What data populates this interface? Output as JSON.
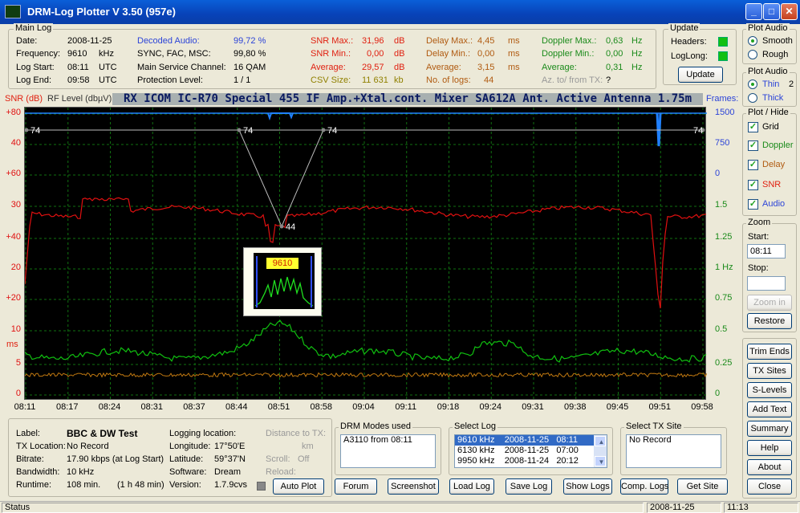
{
  "window": {
    "title": "DRM-Log Plotter  V 3.50   (957e)",
    "min": "_",
    "max": "□",
    "close": "✕"
  },
  "mainlog": {
    "legend": "Main Log",
    "date_l": "Date:",
    "date_v": "2008-11-25",
    "freq_l": "Frequency:",
    "freq_v": "9610",
    "freq_u": "kHz",
    "start_l": "Log Start:",
    "start_v": "08:11",
    "start_u": "UTC",
    "end_l": "Log End:",
    "end_v": "09:58",
    "end_u": "UTC",
    "audio_l": "Decoded Audio:",
    "audio_v": "99,72 %",
    "sync_l": "SYNC, FAC, MSC:",
    "sync_v": "99,80 %",
    "msc_l": "Main Service Channel:",
    "msc_v": "16  QAM",
    "prot_l": "Protection Level:",
    "prot_v": "1 / 1",
    "snrmax_l": "SNR Max.:",
    "snrmax_v": "31,96",
    "snrmax_u": "dB",
    "snrmin_l": "SNR Min.:",
    "snrmin_v": "0,00",
    "snrmin_u": "dB",
    "snravg_l": "Average:",
    "snravg_v": "29,57",
    "snravg_u": "dB",
    "csv_l": "CSV Size:",
    "csv_v": "11 631",
    "csv_u": "kb",
    "dmax_l": "Delay Max.:",
    "dmax_v": "4,45",
    "dmax_u": "ms",
    "dmin_l": "Delay Min.:",
    "dmin_v": "0,00",
    "dmin_u": "ms",
    "davg_l": "Average:",
    "davg_v": "3,15",
    "davg_u": "ms",
    "nlogs_l": "No. of logs:",
    "nlogs_v": "44",
    "domax_l": "Doppler Max.:",
    "domax_v": "0,63",
    "domax_u": "Hz",
    "domin_l": "Doppler Min.:",
    "domin_v": "0,00",
    "domin_u": "Hz",
    "doavg_l": "Average:",
    "doavg_v": "0,31",
    "doavg_u": "Hz",
    "az_l": "Az. to/ from TX:",
    "az_v": "?"
  },
  "update": {
    "legend": "Update",
    "headers": "Headers:",
    "loglong": "LogLong:",
    "button": "Update"
  },
  "plotaudio": {
    "legend": "Plot Audio",
    "smooth": "Smooth",
    "rough": "Rough"
  },
  "plotaudio2": {
    "legend": "Plot Audio",
    "thin": "Thin",
    "thick": "Thick",
    "num": "2"
  },
  "plothide": {
    "legend": "Plot / Hide",
    "grid": "Grid",
    "doppler": "Doppler",
    "delay": "Delay",
    "snr": "SNR",
    "audio": "Audio"
  },
  "zoom": {
    "legend": "Zoom",
    "start_l": "Start:",
    "start_v": "08:11",
    "stop_l": "Stop:",
    "stop_v": "",
    "zoomin": "Zoom in",
    "restore": "Restore"
  },
  "rightbtns": [
    "Trim Ends",
    "TX Sites",
    "S-Levels",
    "Add Text",
    "Summary",
    "Help",
    "About",
    "Close"
  ],
  "plot": {
    "snr_label": "SNR (dB)",
    "rf_label": "RF Level (dbµV)",
    "banner": "RX ICOM IC-R70  Special 455 IF Amp.+Xtal.cont. Mixer SA612A  Ant. Active Antenna 1.75m",
    "frames_label": "Frames:",
    "ms_label": "ms",
    "left_ticks": [
      "+80",
      "40",
      "+60",
      "30",
      "+40",
      "20",
      "+20",
      "10",
      "5",
      "0"
    ],
    "right_ticks": [
      "1500",
      "750",
      "0",
      "1.5",
      "1.25",
      "1 Hz",
      "0.75",
      "0.5",
      "0.25",
      "0"
    ],
    "x_ticks": [
      "08:11",
      "08:17",
      "08:24",
      "08:31",
      "08:37",
      "08:44",
      "08:51",
      "08:58",
      "09:04",
      "09:11",
      "09:18",
      "09:24",
      "09:31",
      "09:38",
      "09:45",
      "09:51",
      "09:58"
    ],
    "markers": [
      "74",
      "74",
      "74",
      "74",
      "44"
    ],
    "spectrum_label": "9610",
    "colors": {
      "snr": "#e01010",
      "doppler": "#10c010",
      "delay": "#c07810",
      "frames": "#2080ff",
      "grid": "#107010"
    }
  },
  "info": {
    "label_l": "Label:",
    "label_v": "BBC & DW Test",
    "txloc_l": "TX Location:",
    "txloc_v": "No Record",
    "bitrate_l": "Bitrate:",
    "bitrate_v": "17.90 kbps (at Log Start)",
    "bw_l": "Bandwidth:",
    "bw_v": "10 kHz",
    "rt_l": "Runtime:",
    "rt_v": "108   min.",
    "rt_v2": "(1 h 48 min)",
    "logloc_l": "Logging location:",
    "lon_l": "Longitude:",
    "lon_v": "17°50'E",
    "lat_l": "Latitude:",
    "lat_v": "59°37'N",
    "sw_l": "Software:",
    "sw_v": "Dream",
    "ver_l": "Version:",
    "ver_v": "1.7.9cvs",
    "dist_l": "Distance to TX:",
    "dist_u": "km",
    "scroll_l": "Scroll:",
    "scroll_v": "Off",
    "reload_l": "Reload:",
    "autoplot": "Auto Plot"
  },
  "drmmodes": {
    "legend": "DRM Modes used",
    "items": [
      "A3110 from 08:11"
    ]
  },
  "selectlog": {
    "legend": "Select Log",
    "items": [
      "9610 kHz    2008-11-25   08:11",
      "6130 kHz    2008-11-25   07:00",
      "9950 kHz    2008-11-24   20:12"
    ]
  },
  "selecttx": {
    "legend": "Select TX Site",
    "items": [
      "No Record"
    ]
  },
  "bottombtns": {
    "forum": "Forum",
    "screenshot": "Screenshot",
    "loadlog": "Load Log",
    "savelog": "Save Log",
    "showlogs": "Show Logs",
    "complogs": "Comp. Logs",
    "getsite": "Get Site"
  },
  "statusbar": {
    "status": "Status",
    "date": "2008-11-25",
    "time": "11:13"
  }
}
